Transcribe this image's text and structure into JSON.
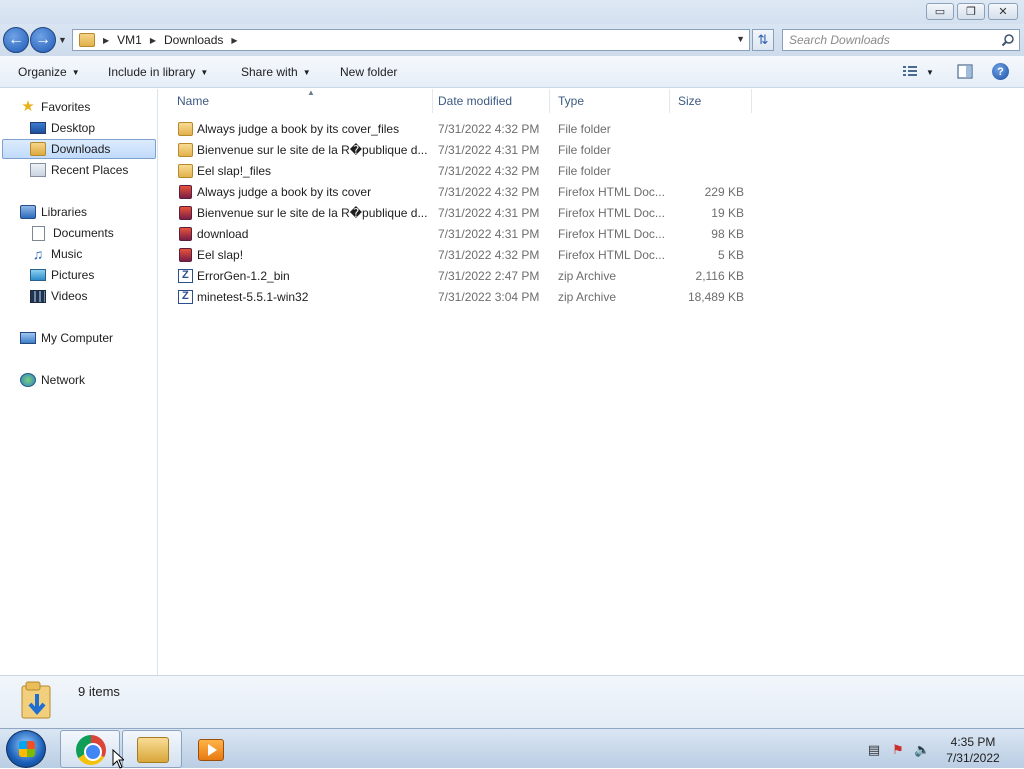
{
  "window": {
    "controls": {
      "minimize": "▭",
      "maximize": "❐",
      "close": "✕"
    }
  },
  "address": {
    "crumbs": [
      "VM1",
      "Downloads"
    ]
  },
  "search": {
    "placeholder": "Search Downloads"
  },
  "commands": {
    "organize": "Organize",
    "include_in_library": "Include in library",
    "share_with": "Share with",
    "new_folder": "New folder"
  },
  "nav": {
    "favorites": "Favorites",
    "desktop": "Desktop",
    "downloads": "Downloads",
    "recent_places": "Recent Places",
    "libraries": "Libraries",
    "documents": "Documents",
    "music": "Music",
    "pictures": "Pictures",
    "videos": "Videos",
    "my_computer": "My Computer",
    "network": "Network"
  },
  "columns": {
    "name": "Name",
    "date": "Date modified",
    "type": "Type",
    "size": "Size"
  },
  "files": [
    {
      "icon": "folder-icon",
      "name": "Always judge a book by its cover_files",
      "date": "7/31/2022 4:32 PM",
      "type": "File folder",
      "size": ""
    },
    {
      "icon": "folder-icon",
      "name": "Bienvenue sur le site de la R�publique d...",
      "date": "7/31/2022 4:31 PM",
      "type": "File folder",
      "size": ""
    },
    {
      "icon": "folder-icon",
      "name": "Eel slap!_files",
      "date": "7/31/2022 4:32 PM",
      "type": "File folder",
      "size": ""
    },
    {
      "icon": "firefox-html-icon",
      "name": "Always judge a book by its cover",
      "date": "7/31/2022 4:32 PM",
      "type": "Firefox HTML Doc...",
      "size": "229 KB"
    },
    {
      "icon": "firefox-html-icon",
      "name": "Bienvenue sur le site de la R�publique d...",
      "date": "7/31/2022 4:31 PM",
      "type": "Firefox HTML Doc...",
      "size": "19 KB"
    },
    {
      "icon": "firefox-html-icon",
      "name": "download",
      "date": "7/31/2022 4:31 PM",
      "type": "Firefox HTML Doc...",
      "size": "98 KB"
    },
    {
      "icon": "firefox-html-icon",
      "name": "Eel slap!",
      "date": "7/31/2022 4:32 PM",
      "type": "Firefox HTML Doc...",
      "size": "5 KB"
    },
    {
      "icon": "zip-archive-icon",
      "name": "ErrorGen-1.2_bin",
      "date": "7/31/2022 2:47 PM",
      "type": "zip Archive",
      "size": "2,116 KB"
    },
    {
      "icon": "zip-archive-icon",
      "name": "minetest-5.5.1-win32",
      "date": "7/31/2022 3:04 PM",
      "type": "zip Archive",
      "size": "18,489 KB"
    }
  ],
  "details": {
    "item_count": "9 items"
  },
  "taskbar": {
    "clock_time": "4:35 PM",
    "clock_date": "7/31/2022"
  }
}
